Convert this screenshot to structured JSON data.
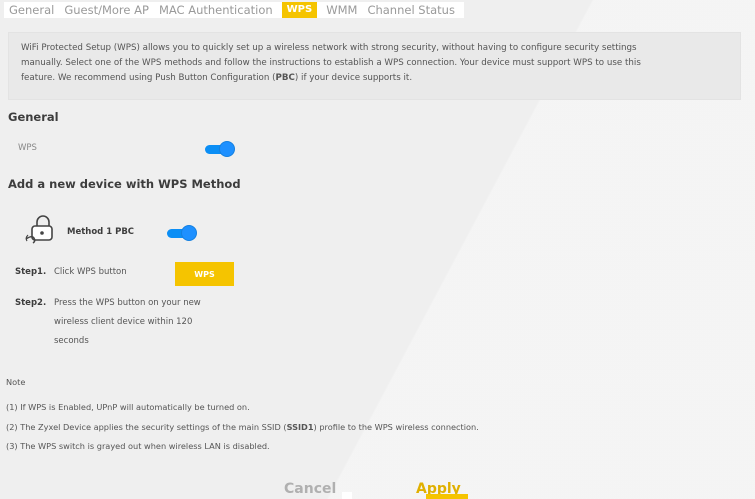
{
  "tabs": [
    {
      "label": "General"
    },
    {
      "label": "Guest/More AP"
    },
    {
      "label": "MAC Authentication"
    },
    {
      "label": "WPS"
    },
    {
      "label": "WMM"
    },
    {
      "label": "Channel Status"
    }
  ],
  "active_tab": "WPS",
  "info": {
    "line1": "WiFi Protected Setup (WPS) allows you to quickly set up a wireless network with strong security, without having to configure security settings",
    "line2": "manually. Select one of the WPS methods and follow the instructions to establish a WPS connection. Your device must support WPS to use this",
    "line3_a": "feature. We recommend using Push Button Configuration (",
    "line3_b": "PBC",
    "line3_c": ") if your device supports it."
  },
  "general": {
    "title": "General",
    "wps_label": "WPS",
    "wps_enabled": true
  },
  "method": {
    "title": "Add a new device with WPS Method",
    "method1_label": "Method 1 PBC",
    "method1_enabled": true,
    "step1_label": "Step1.",
    "step1_text": "Click WPS button",
    "wps_button": "WPS",
    "step2_label": "Step2.",
    "step2_line1": "Press the WPS button on your new",
    "step2_line2": "wireless client device within 120",
    "step2_line3": "seconds"
  },
  "note": {
    "title": "Note",
    "line1": "(1) If WPS is Enabled, UPnP will automatically be turned on.",
    "line2_a": "(2) The Zyxel Device applies the security settings of the main SSID (",
    "line2_b": "SSID1",
    "line2_c": ") profile to the WPS wireless connection.",
    "line3": "(3) The WPS switch is grayed out when wireless LAN is disabled."
  },
  "footer": {
    "cancel": "Cancel",
    "apply": "Apply"
  },
  "colors": {
    "accent": "#f5c400",
    "toggle": "#1e90ff",
    "background": "#efefef"
  },
  "icons": {
    "method1": "push-button-lock-icon"
  }
}
